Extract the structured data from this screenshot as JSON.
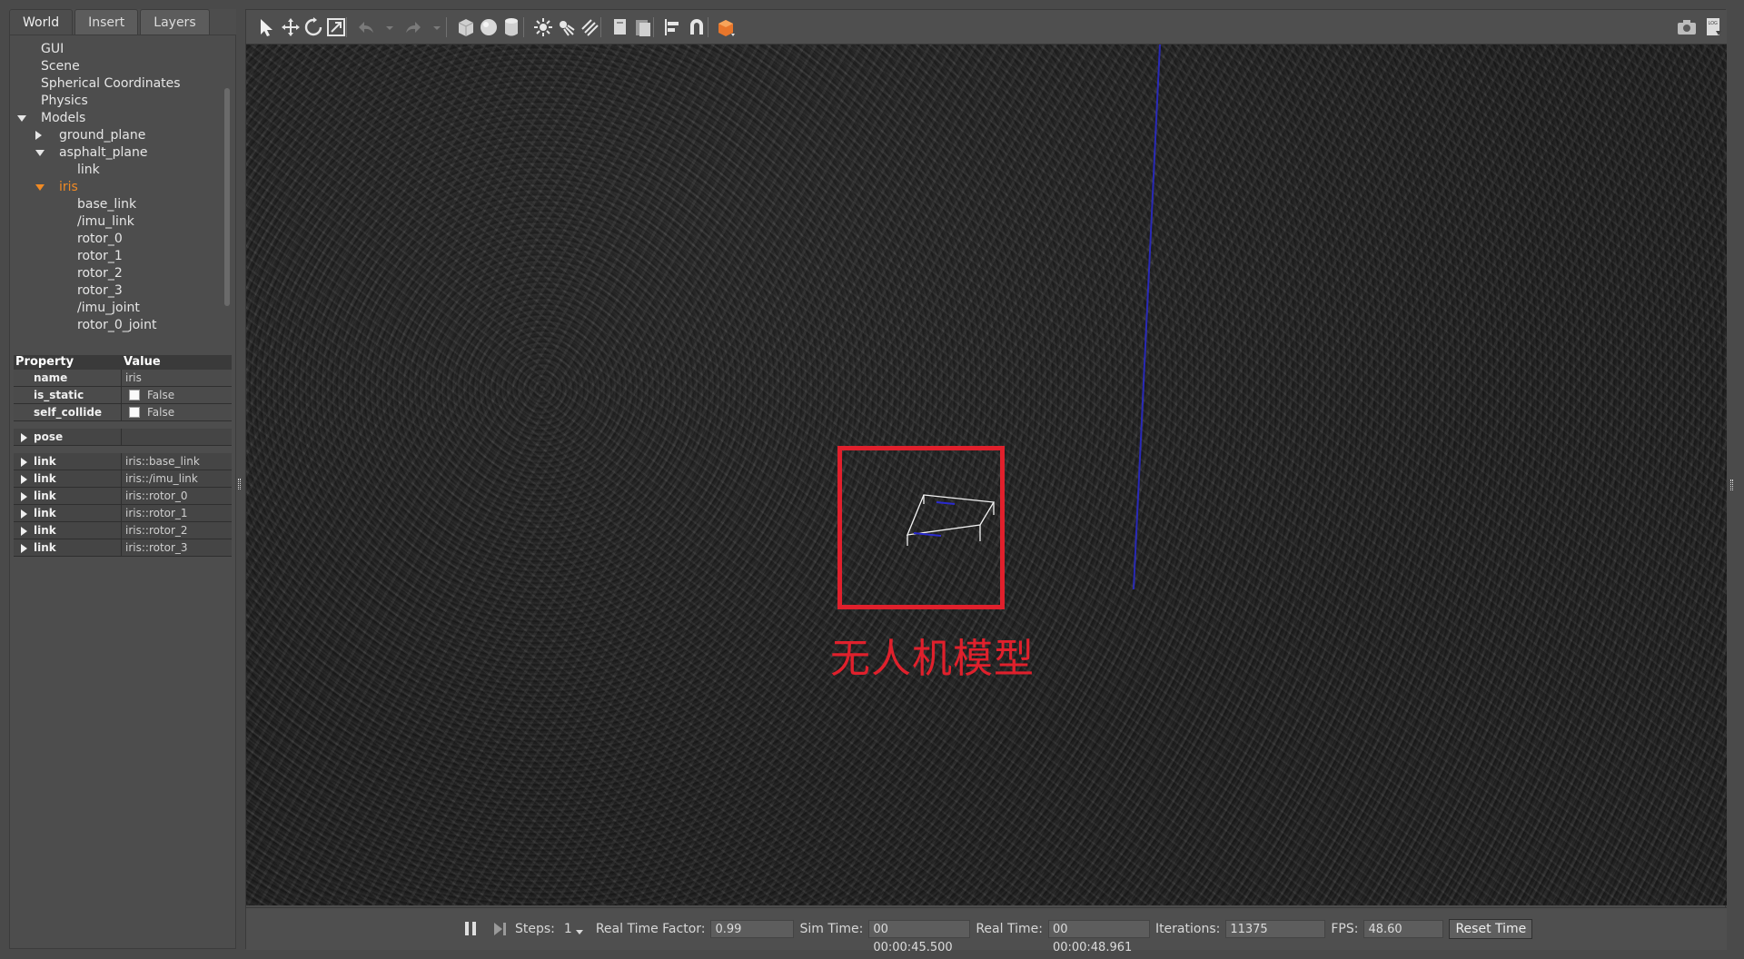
{
  "tabs": [
    {
      "label": "World"
    },
    {
      "label": "Insert"
    },
    {
      "label": "Layers"
    }
  ],
  "tree": {
    "items": [
      {
        "label": "GUI",
        "depth": 0,
        "arrow": "none"
      },
      {
        "label": "Scene",
        "depth": 0,
        "arrow": "none"
      },
      {
        "label": "Spherical Coordinates",
        "depth": 0,
        "arrow": "none"
      },
      {
        "label": "Physics",
        "depth": 0,
        "arrow": "none"
      },
      {
        "label": "Models",
        "depth": 0,
        "arrow": "down"
      },
      {
        "label": "ground_plane",
        "depth": 1,
        "arrow": "right"
      },
      {
        "label": "asphalt_plane",
        "depth": 1,
        "arrow": "down"
      },
      {
        "label": "link",
        "depth": 2,
        "arrow": "none"
      },
      {
        "label": "iris",
        "depth": 1,
        "arrow": "down",
        "selected": true
      },
      {
        "label": "base_link",
        "depth": 2,
        "arrow": "none"
      },
      {
        "label": "/imu_link",
        "depth": 2,
        "arrow": "none"
      },
      {
        "label": "rotor_0",
        "depth": 2,
        "arrow": "none"
      },
      {
        "label": "rotor_1",
        "depth": 2,
        "arrow": "none"
      },
      {
        "label": "rotor_2",
        "depth": 2,
        "arrow": "none"
      },
      {
        "label": "rotor_3",
        "depth": 2,
        "arrow": "none"
      },
      {
        "label": "/imu_joint",
        "depth": 2,
        "arrow": "none"
      },
      {
        "label": "rotor_0_joint",
        "depth": 2,
        "arrow": "none"
      }
    ]
  },
  "properties": {
    "header": {
      "property": "Property",
      "value": "Value"
    },
    "rows": [
      {
        "name": "name",
        "value": "iris",
        "kind": "text"
      },
      {
        "name": "is_static",
        "value": "False",
        "kind": "checkbox"
      },
      {
        "name": "self_collide",
        "value": "False",
        "kind": "checkbox"
      },
      {
        "name": "pose",
        "value": "",
        "kind": "group",
        "gap_before": true
      },
      {
        "name": "link",
        "value": "iris::base_link",
        "kind": "group",
        "gap_before": true
      },
      {
        "name": "link",
        "value": "iris::/imu_link",
        "kind": "group"
      },
      {
        "name": "link",
        "value": "iris::rotor_0",
        "kind": "group"
      },
      {
        "name": "link",
        "value": "iris::rotor_1",
        "kind": "group"
      },
      {
        "name": "link",
        "value": "iris::rotor_2",
        "kind": "group"
      },
      {
        "name": "link",
        "value": "iris::rotor_3",
        "kind": "group"
      }
    ]
  },
  "toolbar": {
    "icons": [
      "select-mode-icon",
      "translate-mode-icon",
      "rotate-mode-icon",
      "scale-mode-icon",
      "undo-icon",
      "undo-history-icon",
      "redo-icon",
      "redo-history-icon",
      "box-shape-icon",
      "sphere-shape-icon",
      "cylinder-shape-icon",
      "point-light-icon",
      "spot-light-icon",
      "directional-light-icon",
      "copy-icon",
      "paste-icon",
      "align-icon",
      "snap-icon",
      "view-angle-icon"
    ],
    "right_icons": [
      "screenshot-icon",
      "log-icon"
    ]
  },
  "annotation": {
    "text": "无人机模型",
    "color": "#e0202c"
  },
  "bottom_bar": {
    "steps_label": "Steps:",
    "steps_value": "1",
    "rtf_label": "Real Time Factor:",
    "rtf_value": "0.99",
    "sim_time_label": "Sim Time:",
    "sim_time_value": "00 00:00:45.500",
    "real_time_label": "Real Time:",
    "real_time_value": "00 00:00:48.961",
    "iterations_label": "Iterations:",
    "iterations_value": "11375",
    "fps_label": "FPS:",
    "fps_value": "48.60",
    "reset_label": "Reset Time"
  },
  "colors": {
    "selected_tree_item": "#f08a24",
    "z_axis_line": "#2a2ad0",
    "panel_bg": "#4d4d4d"
  }
}
